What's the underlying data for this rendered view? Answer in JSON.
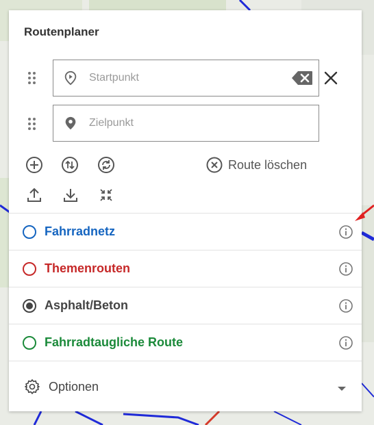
{
  "panel": {
    "title": "Routenplaner",
    "start": {
      "placeholder": "Startpunkt",
      "value": ""
    },
    "end": {
      "placeholder": "Zielpunkt",
      "value": ""
    },
    "clear_route_label": "Route löschen",
    "layers": [
      {
        "label": "Fahrradnetz",
        "color": "#1565c0",
        "selected": false
      },
      {
        "label": "Themenrouten",
        "color": "#c62828",
        "selected": false
      },
      {
        "label": "Asphalt/Beton",
        "color": "#444444",
        "selected": true
      },
      {
        "label": "Fahrradtaugliche Route",
        "color": "#1b8a3a",
        "selected": false
      }
    ],
    "options_label": "Optionen"
  },
  "colors": {
    "annotation_arrow": "#e02020",
    "map_routes": "#1f2ad8"
  }
}
